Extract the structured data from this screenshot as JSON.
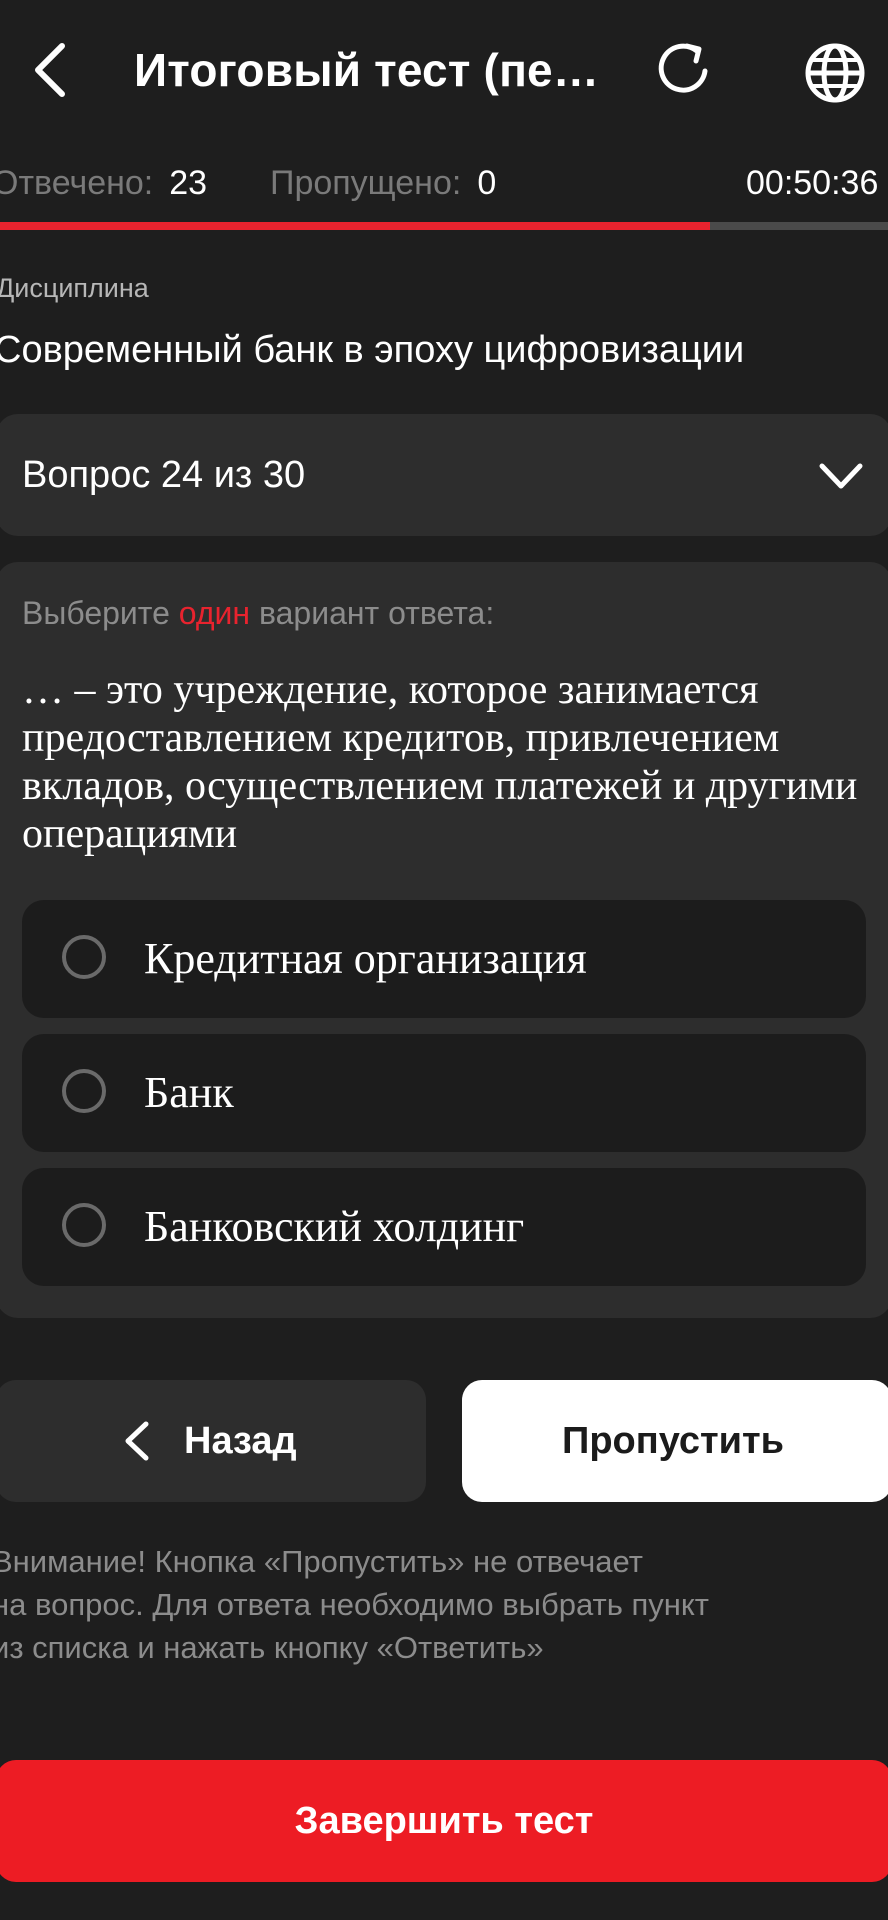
{
  "header": {
    "title": "Итоговый тест (пе…",
    "back_icon": "chevron-left-icon",
    "refresh_icon": "refresh-icon",
    "language_icon": "globe-icon"
  },
  "stats": {
    "answered_label": "Отвечено:",
    "answered_value": "23",
    "skipped_label": "Пропущено:",
    "skipped_value": "0",
    "timer": "00:50:36",
    "progress_fraction": 0.8
  },
  "discipline": {
    "label": "Дисциплина",
    "name": "Современный банк в эпоху цифровизации"
  },
  "question_selector": {
    "label": "Вопрос 24 из 30",
    "icon": "chevron-down-icon"
  },
  "question": {
    "instruction_prefix": "Выберите ",
    "instruction_accent": "один",
    "instruction_suffix": " вариант ответа:",
    "text": "… – это учреждение, которое занимается предоставлением кредитов, привлечением вкладов, осуществлением платежей и другими операциями",
    "options": [
      {
        "label": "Кредитная организация",
        "selected": false
      },
      {
        "label": "Банк",
        "selected": false
      },
      {
        "label": "Банковский холдинг",
        "selected": false
      }
    ]
  },
  "actions": {
    "back_label": "Назад",
    "skip_label": "Пропустить",
    "finish_label": "Завершить тест"
  },
  "warning": {
    "line1": "Внимание! Кнопка «Пропустить» не отвечает",
    "line2": "на вопрос. Для ответа необходимо выбрать пункт",
    "line3": "из списка и нажать кнопку «Ответить»"
  },
  "colors": {
    "background": "#1e1e1e",
    "card": "#2d2d2d",
    "option": "#1c1c1c",
    "accent": "#e8232e",
    "finish": "#ed1c24"
  }
}
